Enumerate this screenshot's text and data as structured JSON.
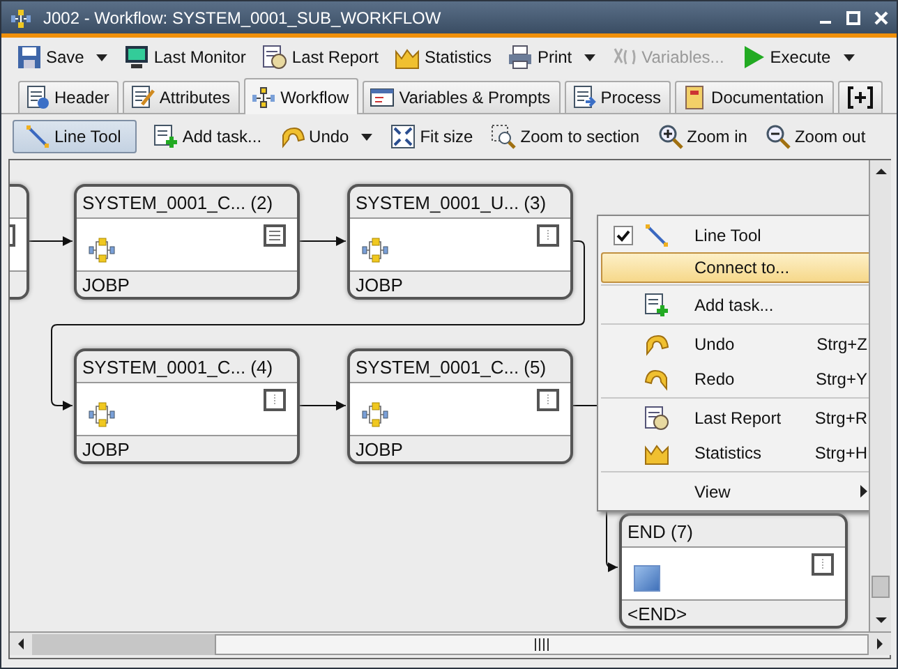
{
  "window": {
    "title": "J002 - Workflow: SYSTEM_0001_SUB_WORKFLOW"
  },
  "toolbar": [
    {
      "label": "Save",
      "dropdown": true,
      "disabled": false
    },
    {
      "label": "Last Monitor",
      "dropdown": false,
      "disabled": false
    },
    {
      "label": "Last Report",
      "dropdown": false,
      "disabled": false
    },
    {
      "label": "Statistics",
      "dropdown": false,
      "disabled": false
    },
    {
      "label": "Print",
      "dropdown": true,
      "disabled": false
    },
    {
      "label": "Variables...",
      "dropdown": false,
      "disabled": true
    },
    {
      "label": "Execute",
      "dropdown": true,
      "disabled": false
    }
  ],
  "tabs": [
    {
      "label": "Header",
      "selected": false
    },
    {
      "label": "Attributes",
      "selected": false
    },
    {
      "label": "Workflow",
      "selected": true
    },
    {
      "label": "Variables & Prompts",
      "selected": false
    },
    {
      "label": "Process",
      "selected": false
    },
    {
      "label": "Documentation",
      "selected": false
    }
  ],
  "canvas_toolbar": [
    {
      "label": "Line Tool",
      "pressed": true,
      "dropdown": false
    },
    {
      "label": "Add task...",
      "pressed": false,
      "dropdown": false
    },
    {
      "label": "Undo",
      "pressed": false,
      "dropdown": true
    },
    {
      "label": "Fit size",
      "pressed": false,
      "dropdown": false
    },
    {
      "label": "Zoom to section",
      "pressed": false,
      "dropdown": false
    },
    {
      "label": "Zoom in",
      "pressed": false,
      "dropdown": false
    },
    {
      "label": "Zoom out",
      "pressed": false,
      "dropdown": false
    }
  ],
  "nodes": [
    {
      "kind": "clipped"
    },
    {
      "kind": "workflow",
      "title": "SYSTEM_0001_C... (2)",
      "type": "JOBP"
    },
    {
      "kind": "workflow",
      "title": "SYSTEM_0001_U... (3)",
      "type": "JOBP"
    },
    {
      "kind": "workflow",
      "title": "SYSTEM_0001_C... (4)",
      "type": "JOBP"
    },
    {
      "kind": "workflow",
      "title": "SYSTEM_0001_C... (5)",
      "type": "JOBP"
    },
    {
      "kind": "end",
      "title": "END (7)",
      "type": "<END>"
    }
  ],
  "context_menu": [
    {
      "kind": "item",
      "label": "Line Tool",
      "checked": true,
      "highlighted": false
    },
    {
      "kind": "item",
      "label": "Connect to...",
      "checked": false,
      "highlighted": true
    },
    {
      "kind": "separator"
    },
    {
      "kind": "item",
      "label": "Add task...",
      "checked": false,
      "highlighted": false
    },
    {
      "kind": "separator"
    },
    {
      "kind": "item",
      "label": "Undo",
      "shortcut": "Strg+Z",
      "checked": false,
      "highlighted": false
    },
    {
      "kind": "item",
      "label": "Redo",
      "shortcut": "Strg+Y",
      "checked": false,
      "highlighted": false
    },
    {
      "kind": "separator"
    },
    {
      "kind": "item",
      "label": "Last Report",
      "shortcut": "Strg+R",
      "checked": false,
      "highlighted": false
    },
    {
      "kind": "item",
      "label": "Statistics",
      "shortcut": "Strg+H",
      "checked": false,
      "highlighted": false
    },
    {
      "kind": "separator"
    },
    {
      "kind": "submenu",
      "label": "View",
      "checked": false,
      "highlighted": false
    }
  ]
}
